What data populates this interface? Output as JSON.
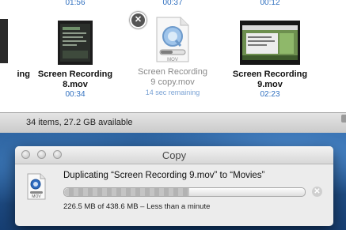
{
  "finder": {
    "top_durations": [
      "01:56",
      "00:37",
      "00:12"
    ],
    "items": [
      {
        "name_line1": "",
        "name_line2": "ing",
        "duration": ""
      },
      {
        "name_line1": "Screen Recording",
        "name_line2": "8.mov",
        "duration": "00:34"
      },
      {
        "name_line1": "Screen Recording",
        "name_line2": "9 copy.mov",
        "duration": "14 sec remaining"
      },
      {
        "name_line1": "Screen Recording",
        "name_line2": "9.mov",
        "duration": "02:23"
      }
    ],
    "status": "34 items, 27.2 GB available",
    "copy_badge": "✕"
  },
  "icons": {
    "cancel_badge": "close-badge-icon",
    "movie_file": "movie-file-icon",
    "quicktime": "quicktime-icon",
    "stop": "stop-icon"
  },
  "dialog": {
    "title": "Copy",
    "message": "Duplicating “Screen Recording 9.mov” to “Movies”",
    "progress": 0.52,
    "detail": "226.5 MB of 438.6 MB – Less than a minute",
    "stop_glyph": "✕",
    "file_label": "MOV"
  }
}
